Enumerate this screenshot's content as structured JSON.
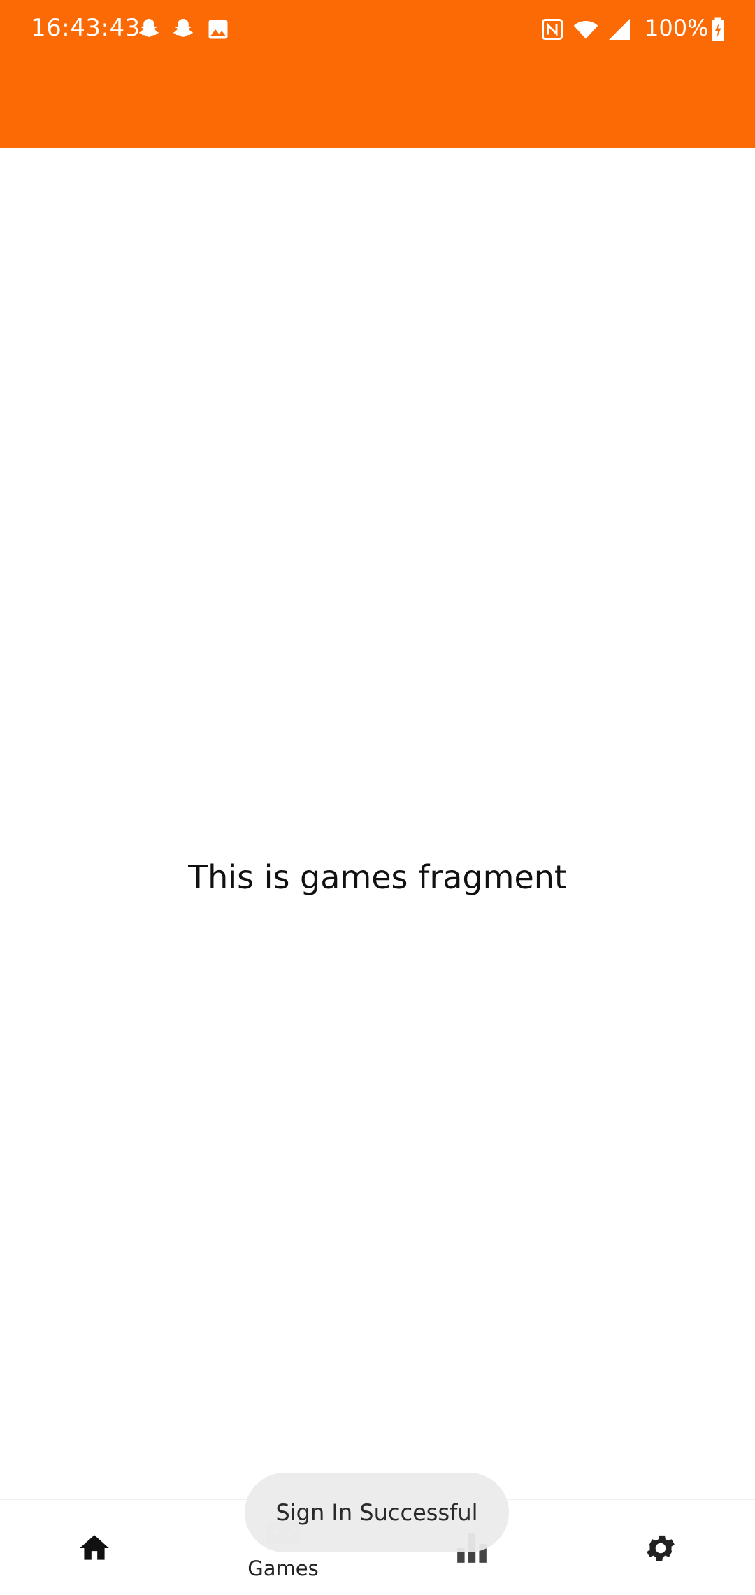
{
  "colors": {
    "accent": "#fb6a05",
    "nav_active": "#111111",
    "nav_inactive": "#444444"
  },
  "status_bar": {
    "time": "16:43:43",
    "battery": "100%",
    "notification_icons": [
      "snapchat-icon",
      "snapchat-icon",
      "image-icon"
    ],
    "system_icons": [
      "nfc-icon",
      "wifi-icon",
      "signal-icon",
      "battery-charging-icon"
    ]
  },
  "content": {
    "text": "This is games fragment"
  },
  "bottom_nav": {
    "items": [
      {
        "id": "home",
        "icon": "home-icon",
        "label": ""
      },
      {
        "id": "games",
        "icon": "gamepad-icon",
        "label": "Games",
        "active": true
      },
      {
        "id": "leaderboard",
        "icon": "bar-chart-icon",
        "label": ""
      },
      {
        "id": "settings",
        "icon": "gear-icon",
        "label": ""
      }
    ]
  },
  "toast": {
    "text": "Sign In Successful"
  }
}
